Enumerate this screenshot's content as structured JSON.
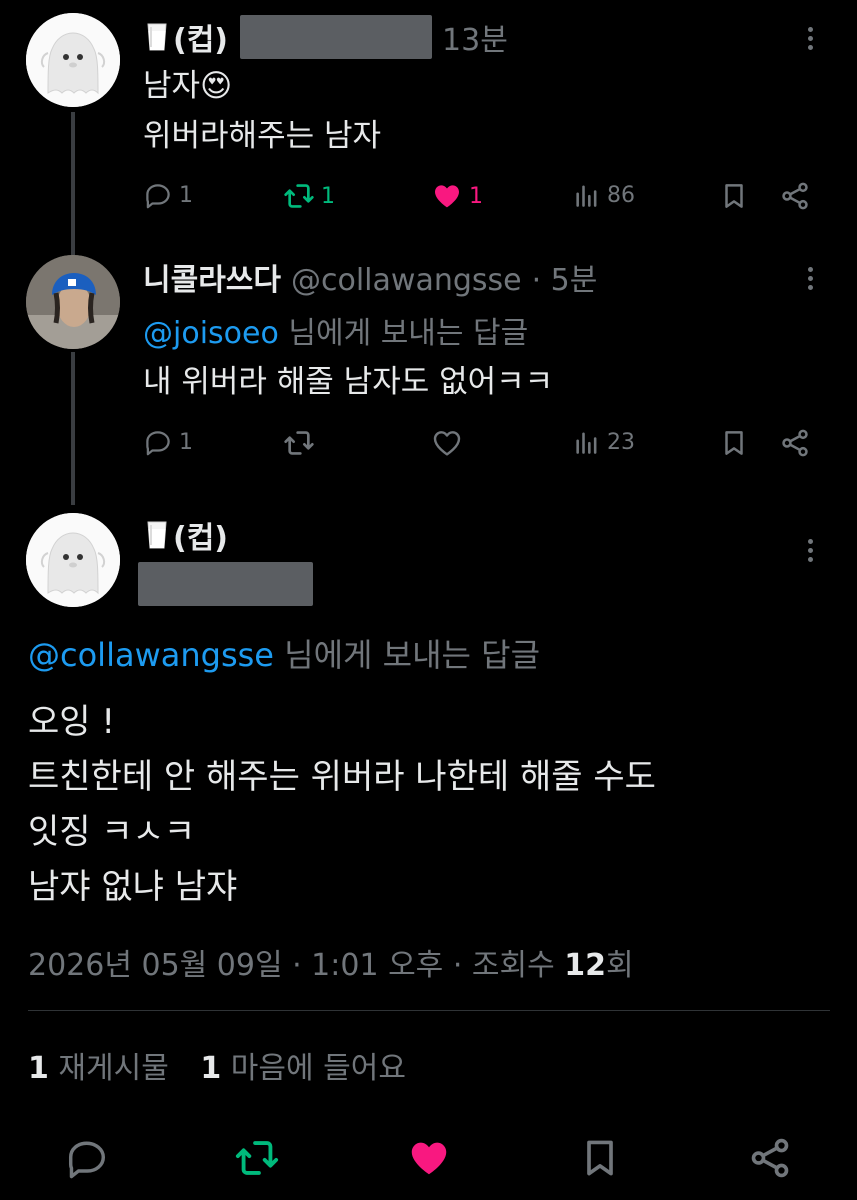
{
  "post1": {
    "display_name": "(컵)",
    "time": "13분",
    "lines": [
      "남자",
      "위버라해주는 남자"
    ],
    "emoji": "😍",
    "actions": {
      "replies": "1",
      "reposts": "1",
      "likes": "1",
      "views": "86"
    }
  },
  "post2": {
    "display_name": "니콜라쓰다",
    "handle": "@collawangsse",
    "time": "· 5분",
    "reply_to_handle": "@joisoeo",
    "reply_to_suffix": "님에게 보내는 답글",
    "text": "내 위버라 해줄 남자도 없어ㅋㅋ",
    "actions": {
      "replies": "1",
      "views": "23"
    }
  },
  "main_post": {
    "display_name": "(컵)",
    "reply_to_handle": "@collawangsse",
    "reply_to_suffix": "님에게 보내는 답글",
    "lines": [
      "오잉 !",
      "트친한테 안 해주는 위버라 나한테 해줄 수도",
      "잇징 ㅋㅅㅋ",
      "남쟈 없냐 남쟈"
    ],
    "timestamp": "2026년 05월 09일 · 1:01 오후 · 조회수",
    "views_count": "12",
    "views_suffix": "회",
    "reposts_count": "1",
    "reposts_label": "재게시물",
    "likes_count": "1",
    "likes_label": "마음에 들어요"
  },
  "icons": {
    "reply": "reply-icon",
    "repost": "repost-icon",
    "like": "heart-icon",
    "views": "views-icon",
    "bookmark": "bookmark-icon",
    "share": "share-icon",
    "more": "more-icon",
    "milk": "milk-glass-icon"
  },
  "colors": {
    "accent": "#1d9bf0",
    "repost_active": "#00ba7c",
    "like_active": "#f91880",
    "muted": "#71767b"
  }
}
